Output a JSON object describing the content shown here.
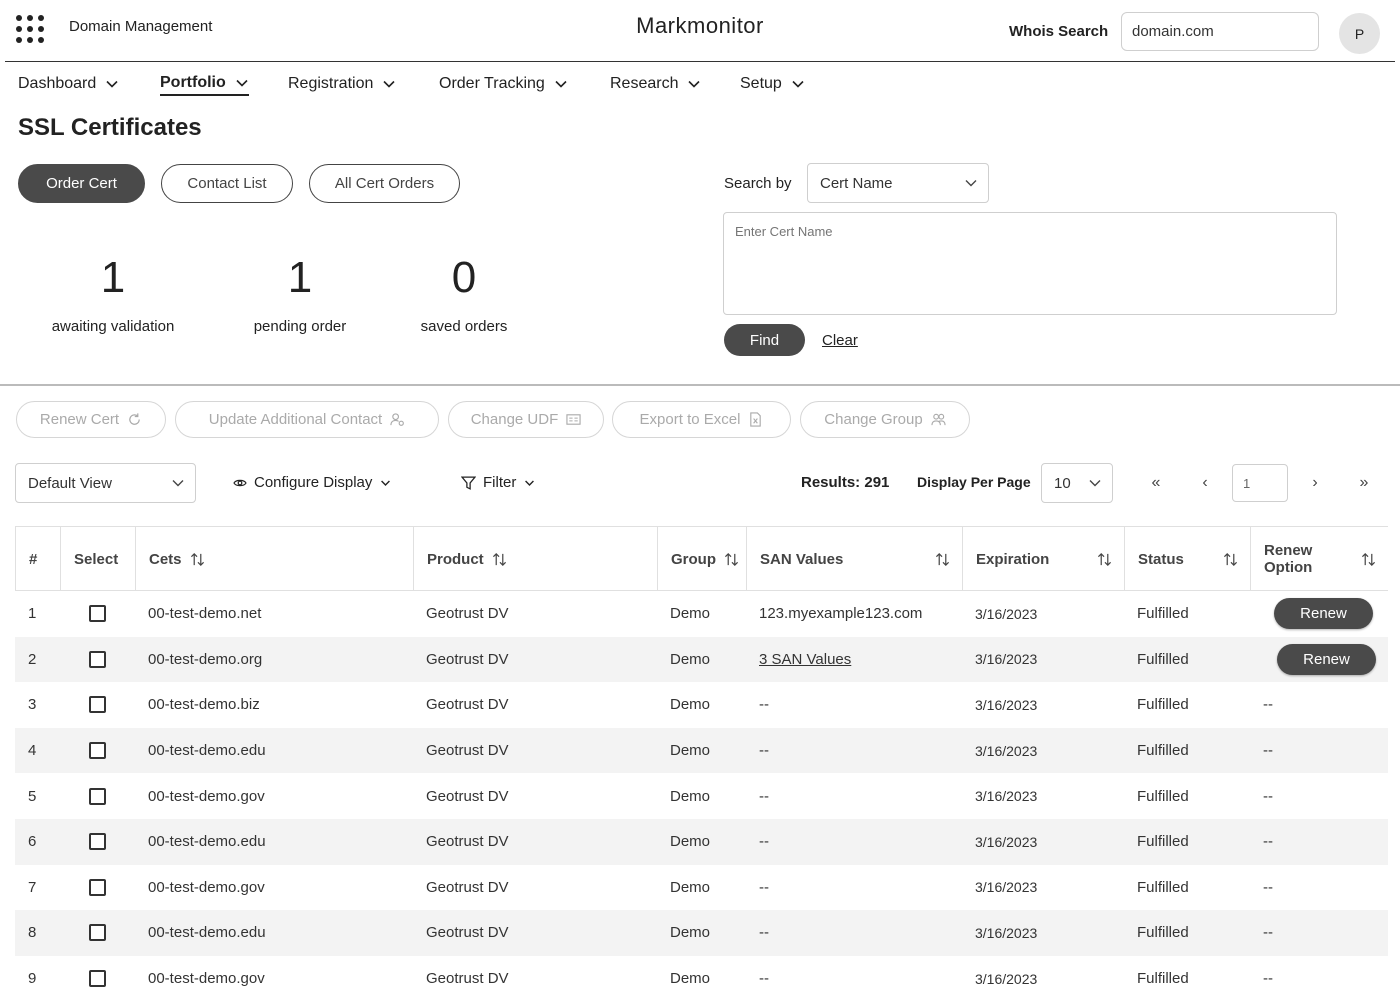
{
  "header": {
    "app_title": "Domain Management",
    "brand": "Markmonitor",
    "whois_label": "Whois Search",
    "whois_value": "domain.com",
    "avatar_initial": "P"
  },
  "nav": [
    {
      "label": "Dashboard",
      "active": false
    },
    {
      "label": "Portfolio",
      "active": true
    },
    {
      "label": "Registration",
      "active": false
    },
    {
      "label": "Order Tracking",
      "active": false
    },
    {
      "label": "Research",
      "active": false
    },
    {
      "label": "Setup",
      "active": false
    }
  ],
  "page_title": "SSL Certificates",
  "buttons": {
    "order_cert": "Order Cert",
    "contact_list": "Contact List",
    "all_cert_orders": "All Cert Orders"
  },
  "stats": [
    {
      "value": "1",
      "label": "awaiting validation"
    },
    {
      "value": "1",
      "label": "pending order"
    },
    {
      "value": "0",
      "label": "saved orders"
    }
  ],
  "search": {
    "label": "Search by",
    "field": "Cert Name",
    "placeholder": "Enter Cert Name",
    "find": "Find",
    "clear": "Clear"
  },
  "actions": [
    {
      "label": "Renew Cert",
      "icon": "refresh-icon"
    },
    {
      "label": "Update Additional Contact",
      "icon": "user-gear-icon"
    },
    {
      "label": "Change UDF",
      "icon": "id-card-icon"
    },
    {
      "label": "Export to Excel",
      "icon": "excel-file-icon"
    },
    {
      "label": "Change Group",
      "icon": "users-icon"
    }
  ],
  "toolbar": {
    "view": "Default View",
    "configure": "Configure Display",
    "filter": "Filter",
    "results": "Results: 291",
    "per_page_label": "Display Per Page",
    "per_page": "10",
    "first": "«",
    "prev": "‹",
    "page": "1",
    "next": "›",
    "last": "»"
  },
  "table": {
    "columns": [
      "#",
      "Select",
      "Cets",
      "Product",
      "Group",
      "SAN Values",
      "Expiration",
      "Status",
      "Renew Option"
    ],
    "rows": [
      {
        "n": "1",
        "cert": "00-test-demo.net",
        "product": "Geotrust DV",
        "group": "Demo",
        "san": "123.myexample123.com",
        "san_link": false,
        "exp": "3/16/2023",
        "status": "Fulfilled",
        "renew": "Renew"
      },
      {
        "n": "2",
        "cert": "00-test-demo.org",
        "product": "Geotrust DV",
        "group": "Demo",
        "san": "3 SAN Values",
        "san_link": true,
        "exp": "3/16/2023",
        "status": "Fulfilled",
        "renew": "Renew"
      },
      {
        "n": "3",
        "cert": "00-test-demo.biz",
        "product": "Geotrust DV",
        "group": "Demo",
        "san": "--",
        "san_link": false,
        "exp": "3/16/2023",
        "status": "Fulfilled",
        "renew": "--"
      },
      {
        "n": "4",
        "cert": "00-test-demo.edu",
        "product": "Geotrust DV",
        "group": "Demo",
        "san": "--",
        "san_link": false,
        "exp": "3/16/2023",
        "status": "Fulfilled",
        "renew": "--"
      },
      {
        "n": "5",
        "cert": "00-test-demo.gov",
        "product": "Geotrust DV",
        "group": "Demo",
        "san": "--",
        "san_link": false,
        "exp": "3/16/2023",
        "status": "Fulfilled",
        "renew": "--"
      },
      {
        "n": "6",
        "cert": "00-test-demo.edu",
        "product": "Geotrust DV",
        "group": "Demo",
        "san": "--",
        "san_link": false,
        "exp": "3/16/2023",
        "status": "Fulfilled",
        "renew": "--"
      },
      {
        "n": "7",
        "cert": "00-test-demo.gov",
        "product": "Geotrust DV",
        "group": "Demo",
        "san": "--",
        "san_link": false,
        "exp": "3/16/2023",
        "status": "Fulfilled",
        "renew": "--"
      },
      {
        "n": "8",
        "cert": "00-test-demo.edu",
        "product": "Geotrust DV",
        "group": "Demo",
        "san": "--",
        "san_link": false,
        "exp": "3/16/2023",
        "status": "Fulfilled",
        "renew": "--"
      },
      {
        "n": "9",
        "cert": "00-test-demo.gov",
        "product": "Geotrust DV",
        "group": "Demo",
        "san": "--",
        "san_link": false,
        "exp": "3/16/2023",
        "status": "Fulfilled",
        "renew": "--"
      }
    ]
  }
}
